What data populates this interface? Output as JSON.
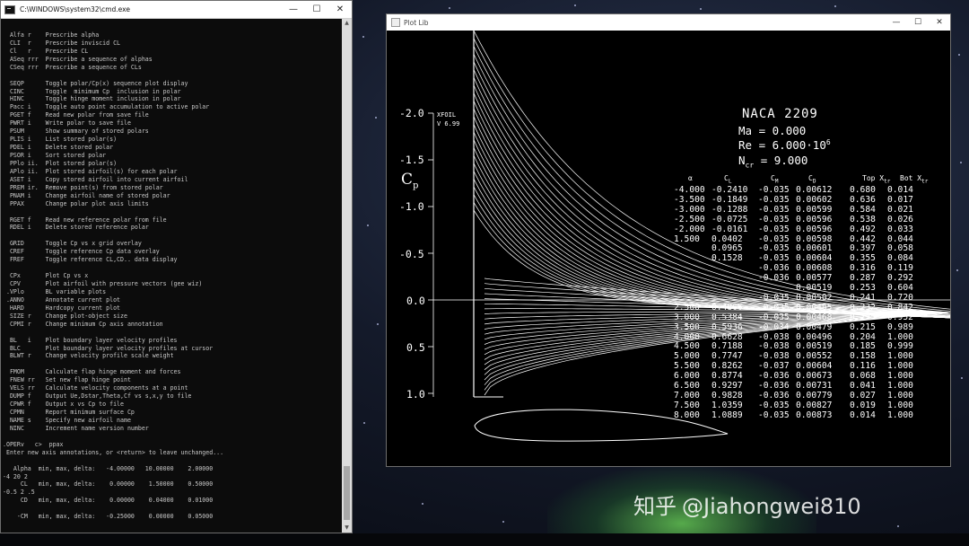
{
  "cmd": {
    "title": "C:\\WINDOWS\\system32\\cmd.exe",
    "lines": [
      "",
      "  Alfa r    Prescribe alpha",
      "  CLI  r    Prescribe inviscid CL",
      "  Cl   r    Prescribe CL",
      "  ASeq rrr  Prescribe a sequence of alphas",
      "  CSeq rrr  Prescribe a sequence of CLs",
      "",
      "  SEQP      Toggle polar/Cp(x) sequence plot display",
      "  CINC      Toggle  minimum Cp  inclusion in polar",
      "  HINC      Toggle hinge moment inclusion in polar",
      "  Pacc i    Toggle auto point accumulation to active polar",
      "  PGET f    Read new polar from save file",
      "  PWRT i    Write polar to save file",
      "  PSUM      Show summary of stored polars",
      "  PLIS i    List stored polar(s)",
      "  PDEL i    Delete stored polar",
      "  PSOR i    Sort stored polar",
      "  PPlo ii.  Plot stored polar(s)",
      "  APlo ii.  Plot stored airfoil(s) for each polar",
      "  ASET i    Copy stored airfoil into current airfoil",
      "  PREM ir.  Remove point(s) from stored polar",
      "  PNAM i    Change airfoil name of stored polar",
      "  PPAX      Change polar plot axis limits",
      "",
      "  RGET f    Read new reference polar from file",
      "  RDEL i    Delete stored reference polar",
      "",
      "  GRID      Toggle Cp vs x grid overlay",
      "  CREF      Toggle reference Cp data overlay",
      "  FREF      Toggle reference CL,CD.. data display",
      "",
      "  CPx       Plot Cp vs x",
      "  CPV       Plot airfoil with pressure vectors (gee wiz)",
      " .VPlo      BL variable plots",
      " .ANNO      Annotate current plot",
      "  HARD      Hardcopy current plot",
      "  SIZE r    Change plot-object size",
      "  CPMI r    Change minimum Cp axis annotation",
      "",
      "  BL   i    Plot boundary layer velocity profiles",
      "  BLC       Plot boundary layer velocity profiles at cursor",
      "  BLWT r    Change velocity profile scale weight",
      "",
      "  FMOM      Calculate flap hinge moment and forces",
      "  FNEW rr   Set new flap hinge point",
      "  VELS rr   Calculate velocity components at a point",
      "  DUMP f    Output Ue,Dstar,Theta,Cf vs s,x,y to file",
      "  CPWR f    Output x vs Cp to file",
      "  CPMN      Report minimum surface Cp",
      "  NAME s    Specify new airfoil name",
      "  NINC      Increment name version number",
      "",
      ".OPERv   c>  ppax",
      " Enter new axis annotations, or <return> to leave unchanged...",
      "",
      "   Alpha  min, max, delta:   -4.00000   10.00000    2.00000",
      "-4 20 2",
      "     CL   min, max, delta:    0.00000    1.50000    0.50000",
      "-0.5 2 .5",
      "     CD   min, max, delta:    0.00000    0.04000    0.01000",
      "",
      "    -CM   min, max, delta:   -0.25000    0.00000    0.05000",
      "",
      " _"
    ]
  },
  "plot": {
    "title": "Plot Lib",
    "xfoil_label": "XFOIL",
    "version": "V 6.99",
    "cp_label": "C",
    "cp_sub": "p",
    "y_ticks": [
      "-2.0",
      "-1.5",
      "-1.0",
      "-0.5",
      "0.0",
      "0.5",
      "1.0"
    ],
    "airfoil_name": "NACA 2209",
    "ma_label": "Ma",
    "ma_value": "0.000",
    "re_label": "Re",
    "re_value": "6.000",
    "re_times": "·10",
    "re_exp": "6",
    "ncr_label": "N",
    "ncr_sub": "cr",
    "ncr_value": "9.000",
    "table_headers": [
      "α",
      "C",
      "C",
      "C",
      "Top X",
      "Bot X"
    ],
    "table_header_subs": [
      "",
      "L",
      "M",
      "D",
      "tr",
      "tr"
    ],
    "table_rows": [
      [
        "-4.000",
        "-0.2410",
        "-0.035",
        "0.00612",
        "0.680",
        "0.014"
      ],
      [
        "-3.500",
        "-0.1849",
        "-0.035",
        "0.00602",
        "0.636",
        "0.017"
      ],
      [
        "-3.000",
        "-0.1288",
        "-0.035",
        "0.00599",
        "0.584",
        "0.021"
      ],
      [
        "-2.500",
        "-0.0725",
        "-0.035",
        "0.00596",
        "0.538",
        "0.026"
      ],
      [
        "-2.000",
        "-0.0161",
        "-0.035",
        "0.00596",
        "0.492",
        "0.033"
      ],
      [
        "1.500",
        "0.0402",
        "-0.035",
        "0.00598",
        "0.442",
        "0.044"
      ],
      [
        "",
        "0.0965",
        "-0.035",
        "0.00601",
        "0.397",
        "0.058"
      ],
      [
        "",
        "0.1528",
        "-0.035",
        "0.00604",
        "0.355",
        "0.084"
      ],
      [
        "",
        "",
        "-0.036",
        "0.00608",
        "0.316",
        "0.119"
      ],
      [
        "",
        "",
        "-0.036",
        "0.00577",
        "0.287",
        "0.292"
      ],
      [
        "",
        "",
        "",
        "0.00519",
        "0.253",
        "0.604"
      ],
      [
        "",
        "",
        "-0.035",
        "0.00502",
        "0.241",
        "0.720"
      ],
      [
        "2.500",
        "0.4866",
        "-0.035",
        "0.00485",
        "0.232",
        "0.842"
      ],
      [
        "3.000",
        "0.5384",
        "-0.035",
        "0.00468",
        "0.225",
        "0.952"
      ],
      [
        "3.500",
        "0.5936",
        "-0.034",
        "0.00479",
        "0.215",
        "0.989"
      ],
      [
        "4.000",
        "0.6628",
        "-0.038",
        "0.00496",
        "0.204",
        "1.000"
      ],
      [
        "4.500",
        "0.7188",
        "-0.038",
        "0.00519",
        "0.185",
        "0.999"
      ],
      [
        "5.000",
        "0.7747",
        "-0.038",
        "0.00552",
        "0.158",
        "1.000"
      ],
      [
        "5.500",
        "0.8262",
        "-0.037",
        "0.00604",
        "0.116",
        "1.000"
      ],
      [
        "6.000",
        "0.8774",
        "-0.036",
        "0.00673",
        "0.068",
        "1.000"
      ],
      [
        "6.500",
        "0.9297",
        "-0.036",
        "0.00731",
        "0.041",
        "1.000"
      ],
      [
        "7.000",
        "0.9828",
        "-0.036",
        "0.00779",
        "0.027",
        "1.000"
      ],
      [
        "7.500",
        "1.0359",
        "-0.035",
        "0.00827",
        "0.019",
        "1.000"
      ],
      [
        "8.000",
        "1.0889",
        "-0.035",
        "0.00873",
        "0.014",
        "1.000"
      ]
    ]
  },
  "watermark": {
    "brand": "知乎",
    "handle": "@Jiahongwei810"
  },
  "colors": {
    "cmd_bg": "#0c0c0c",
    "cmd_text": "#c8c8c8",
    "plot_bg": "#000000",
    "plot_fg": "#ffffff"
  }
}
